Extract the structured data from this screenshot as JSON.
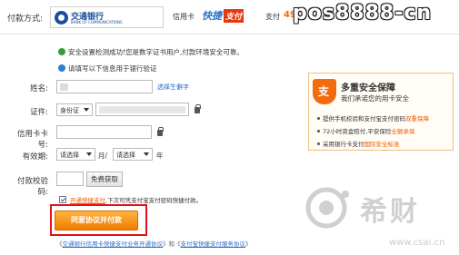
{
  "header": {
    "pay_method_label": "付款方式:",
    "bank_name": "交通银行",
    "bank_en": "BANK OF COMMUNICATIONS",
    "card_type": "信用卡",
    "kuaijie_part1": "快捷",
    "kuaijie_part2": "支付",
    "pay_label": "支付",
    "pay_amount": "49",
    "watermark": "pos8888-cn"
  },
  "notices": {
    "security_ok": "安全设置检测成功!您是数字证书用户,付款环境安全可靠。",
    "fill_info": "请填写以下信息用于银行验证"
  },
  "form": {
    "name_label": "姓名:",
    "name_link": "选择生僻字",
    "id_label": "证件:",
    "id_type": "身份证",
    "card_label": "信用卡卡号:",
    "expiry_label": "有效期:",
    "month_placeholder": "请选择",
    "month_suffix": "月/",
    "year_placeholder": "请选择",
    "year_suffix": "年",
    "code_label": "付款校验码:",
    "code_button": "免费获取",
    "open_fast_pay_link": "开通快捷支付",
    "open_fast_pay_text": ",下次可凭支付宝支付密码快捷付款。",
    "agree_button": "同意协议并付款"
  },
  "security": {
    "title": "多重安全保障",
    "subtitle": "我们承诺您的用卡安全",
    "item1_pre": "提供手机校验和支付宝支付密码",
    "item1_hl": "双重保障",
    "item2_pre": "72小时资金赔付,平安保险",
    "item2_hl": "全额承保",
    "item3_pre": "采用银行卡支付",
    "item3_hl": "国际安全标准"
  },
  "footer": {
    "pre": "《",
    "agreement1": "交通银行信用卡快捷支付业务开通协议",
    "mid": "》和《",
    "agreement2": "支付宝快捷支付服务协议",
    "post": "》"
  },
  "watermark": {
    "text": "希财",
    "url": "www.csai.cn"
  }
}
